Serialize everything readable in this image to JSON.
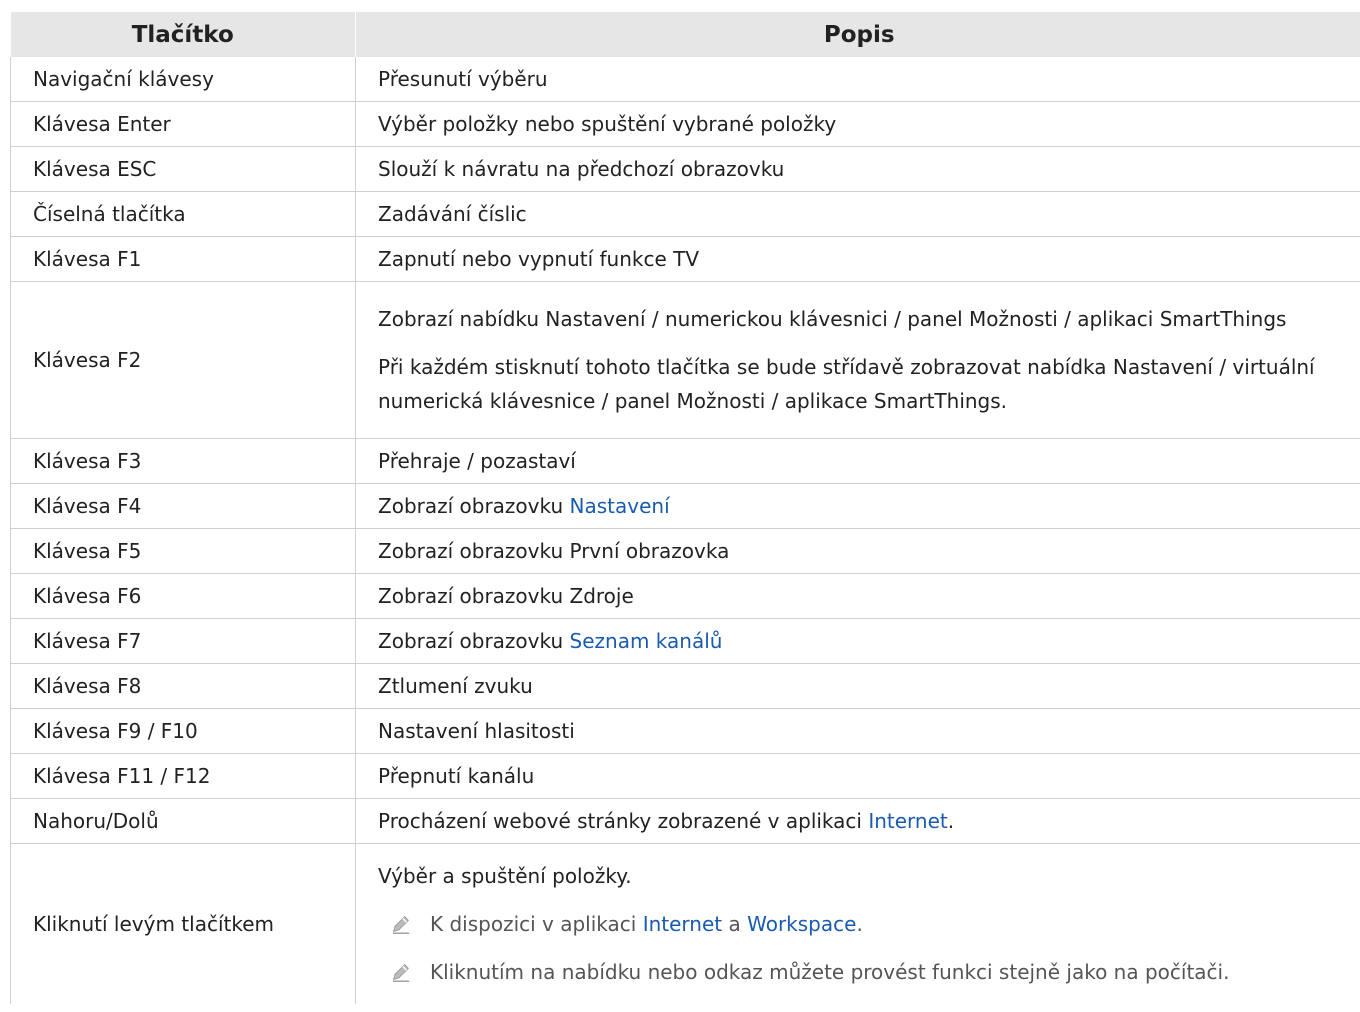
{
  "table": {
    "headers": [
      "Tlačítko",
      "Popis"
    ],
    "rows": [
      {
        "key": "Navigační klávesy",
        "desc": "Přesunutí výběru"
      },
      {
        "key": "Klávesa Enter",
        "desc": "Výběr položky nebo spuštění vybrané položky"
      },
      {
        "key": "Klávesa ESC",
        "desc": "Slouží k návratu na předchozí obrazovku"
      },
      {
        "key": "Číselná tlačítka",
        "desc": "Zadávání číslic"
      },
      {
        "key": "Klávesa F1",
        "desc": "Zapnutí nebo vypnutí funkce TV"
      },
      {
        "key": "Klávesa F2",
        "desc_1": "Zobrazí nabídku Nastavení / numerickou klávesnici / panel Možnosti / aplikaci SmartThings",
        "desc_2": "Při každém stisknutí tohoto tlačítka se bude střídavě zobrazovat nabídka Nastavení / virtuální numerická klávesnice / panel Možnosti / aplikace SmartThings."
      },
      {
        "key": "Klávesa F3",
        "desc": "Přehraje / pozastaví"
      },
      {
        "key": "Klávesa F4",
        "desc_prefix": "Zobrazí obrazovku ",
        "desc_link": "Nastavení"
      },
      {
        "key": "Klávesa F5",
        "desc": "Zobrazí obrazovku První obrazovka"
      },
      {
        "key": "Klávesa F6",
        "desc": "Zobrazí obrazovku Zdroje"
      },
      {
        "key": "Klávesa F7",
        "desc_prefix": "Zobrazí obrazovku ",
        "desc_link": "Seznam kanálů"
      },
      {
        "key": "Klávesa F8",
        "desc": "Ztlumení zvuku"
      },
      {
        "key": "Klávesa F9 / F10",
        "desc": "Nastavení hlasitosti"
      },
      {
        "key": "Klávesa F11 / F12",
        "desc": "Přepnutí kanálu"
      },
      {
        "key": "Nahoru/Dolů",
        "desc_prefix": "Procházení webové stránky zobrazené v aplikaci ",
        "desc_link": "Internet",
        "desc_suffix": "."
      },
      {
        "key": "Kliknutí levým tlačítkem",
        "desc": "Výběr a spuštění položky.",
        "note_1_prefix": "K dispozici v aplikaci ",
        "note_1_link_1": "Internet",
        "note_1_mid": " a ",
        "note_1_link_2": "Workspace",
        "note_1_suffix": ".",
        "note_2": "Kliknutím na nabídku nebo odkaz můžete provést funkci stejně jako na počítači."
      }
    ]
  },
  "colors": {
    "link": "#1a5bb0",
    "header_bg": "#e6e6e6",
    "note_text": "#555555"
  },
  "icons": {
    "note": "pencil-icon"
  }
}
